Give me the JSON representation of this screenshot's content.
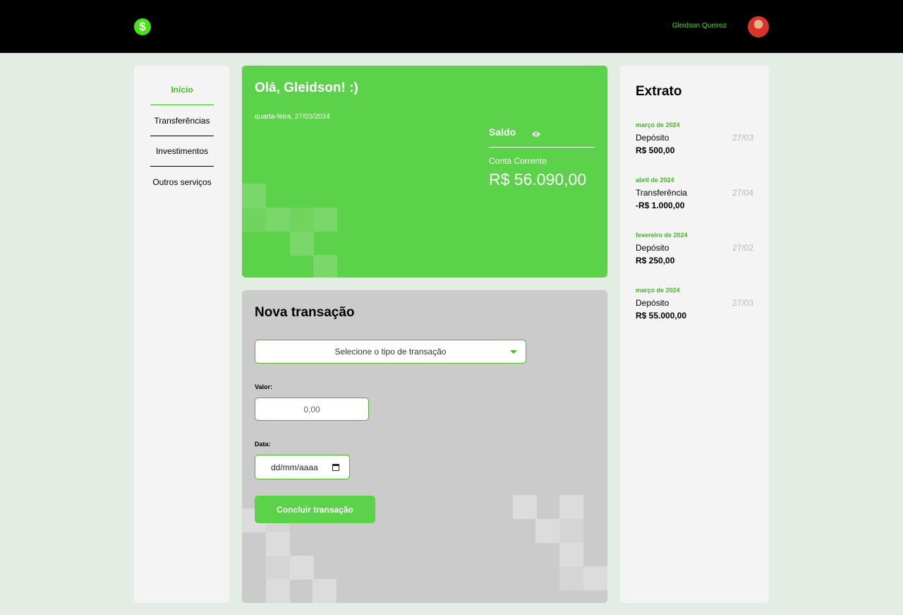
{
  "header": {
    "logo_symbol": "$",
    "user_name": "Gleidson Queiroz",
    "accent_color": "#47e318"
  },
  "sidebar": {
    "items": [
      {
        "label": "Início",
        "active": true
      },
      {
        "label": "Transferências",
        "active": false
      },
      {
        "label": "Investimentos",
        "active": false
      },
      {
        "label": "Outros serviços",
        "active": false
      }
    ]
  },
  "balance": {
    "greeting": "Olá, Gleidson! :)",
    "date": "quarta-feira, 27/03/2024",
    "saldo_label": "Saldo",
    "eye_icon": "eye-icon",
    "account_label": "Conta Corrente",
    "amount": "R$ 56.090,00"
  },
  "transaction": {
    "title": "Nova transação",
    "select_placeholder": "Selecione o tipo de transação",
    "value_label": "Valor:",
    "value_placeholder": "0,00",
    "date_label": "Data:",
    "date_placeholder": "dd/mm/aaaa",
    "submit_label": "Concluir transação"
  },
  "statement": {
    "title": "Extrato",
    "entries": [
      {
        "month": "março de 2024",
        "type": "Depósito",
        "date": "27/03",
        "value": "R$ 500,00"
      },
      {
        "month": "abril de 2024",
        "type": "Transferência",
        "date": "27/04",
        "value": "-R$ 1.000,00"
      },
      {
        "month": "fevereiro de 2024",
        "type": "Depósito",
        "date": "27/02",
        "value": "R$ 250,00"
      },
      {
        "month": "março de 2024",
        "type": "Depósito",
        "date": "27/03",
        "value": "R$ 55.000,00"
      }
    ]
  },
  "colors": {
    "card_green": "#5cd14a",
    "page_bg": "#e4ede3",
    "panel_bg": "#f4f4f4",
    "form_bg": "#cbcbcb"
  }
}
